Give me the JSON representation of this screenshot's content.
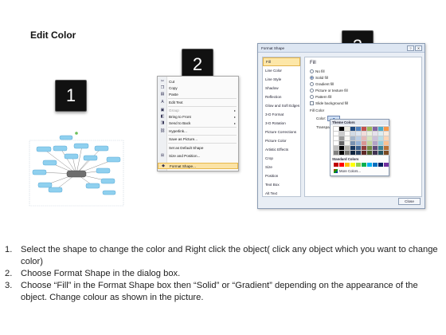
{
  "title": "Edit Color",
  "badges": [
    "1",
    "2",
    "3"
  ],
  "context_menu": {
    "items": [
      {
        "icon": "cut-icon",
        "label": "Cut"
      },
      {
        "icon": "copy-icon",
        "label": "Copy"
      },
      {
        "icon": "paste-icon",
        "label": "Paste"
      },
      {
        "icon": "edit-text-icon",
        "label": "Edit Text"
      },
      {
        "icon": "group-icon",
        "label": "Group"
      },
      {
        "icon": "bring-front-icon",
        "label": "Bring to Front"
      },
      {
        "icon": "send-back-icon",
        "label": "Send to Back"
      },
      {
        "icon": "hyperlink-icon",
        "label": "Hyperlink..."
      },
      {
        "icon": "save-picture-icon",
        "label": "Save as Picture..."
      },
      {
        "icon": "default-shape-icon",
        "label": "Set as Default Shape"
      },
      {
        "icon": "size-position-icon",
        "label": "Size and Position..."
      },
      {
        "icon": "format-shape-icon",
        "label": "Format Shape..."
      }
    ]
  },
  "dialog": {
    "title": "Format Shape",
    "categories": [
      "Fill",
      "Line Color",
      "Line Style",
      "Shadow",
      "Reflection",
      "Glow and Soft Edges",
      "3-D Format",
      "3-D Rotation",
      "Picture Corrections",
      "Picture Color",
      "Artistic Effects",
      "Crop",
      "Size",
      "Position",
      "Text Box",
      "Alt Text"
    ],
    "fill_heading": "Fill",
    "options": [
      "No fill",
      "Solid fill",
      "Gradient fill",
      "Picture or texture fill",
      "Pattern fill"
    ],
    "slide_background": "Slide background fill",
    "fill_color_label": "Fill Color",
    "color_label": "Color:",
    "transparency_label": "Transpa",
    "close_label": "Close"
  },
  "palette": {
    "theme_header": "Theme Colors",
    "standard_header": "Standard Colors",
    "more_label": "More Colors...",
    "theme_columns": [
      "#ffffff",
      "#000000",
      "#eeece1",
      "#1f497d",
      "#4f81bd",
      "#c0504d",
      "#9bbb59",
      "#8064a2",
      "#4bacc6",
      "#f79646"
    ],
    "standard_colors": [
      "#c00000",
      "#ff0000",
      "#ffc000",
      "#ffff00",
      "#92d050",
      "#00b050",
      "#00b0f0",
      "#0070c0",
      "#002060",
      "#7030a0"
    ]
  },
  "steps": [
    {
      "num": "1.",
      "text": "Select the shape to change the color and Right click the object( click any object which you want to change color)"
    },
    {
      "num": "2.",
      "text": "Choose Format Shape in the dialog box."
    },
    {
      "num": "3.",
      "text": "Choose “Fill” in the Format Shape box then “Solid” or “Gradient” depending on the appearance of the object. Change colour as shown in the picture."
    }
  ]
}
